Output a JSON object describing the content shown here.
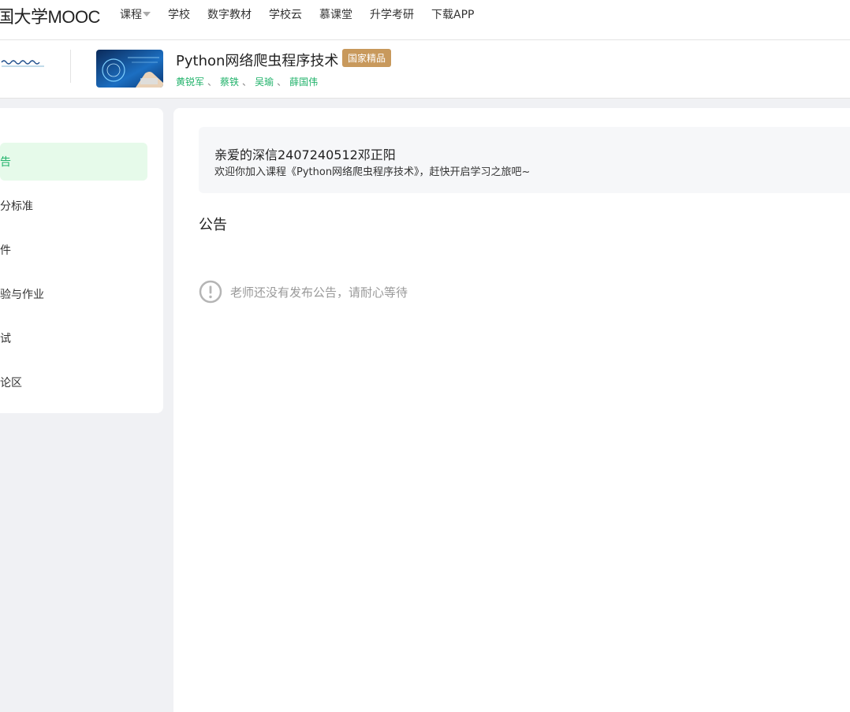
{
  "site": {
    "logo_text": "国大学MOOC"
  },
  "nav": {
    "items": [
      {
        "label": "课程",
        "has_caret": true
      },
      {
        "label": "学校"
      },
      {
        "label": "数字教材"
      },
      {
        "label": "学校云"
      },
      {
        "label": "慕课堂"
      },
      {
        "label": "升学考研"
      },
      {
        "label": "下载APP"
      }
    ]
  },
  "course": {
    "title": "Python网络爬虫程序技术",
    "badge": "国家精品",
    "teachers": [
      "黄锐军",
      "蔡铁",
      "吴瑜",
      "薛国伟"
    ],
    "teacher_separator": "、"
  },
  "sidebar": {
    "items": [
      {
        "label": "告",
        "active": true
      },
      {
        "label": "分标准"
      },
      {
        "label": "件"
      },
      {
        "label": "验与作业"
      },
      {
        "label": "试"
      },
      {
        "label": "论区"
      }
    ]
  },
  "welcome": {
    "name_line": "亲爱的深信2407240512邓正阳",
    "message": "欢迎你加入课程《Python网络爬虫程序技术》，赶快开启学习之旅吧~"
  },
  "announcements": {
    "title": "公告",
    "empty_text": "老师还没有发布公告，请耐心等待"
  },
  "colors": {
    "accent": "#20b26a",
    "badge": "#c8995c",
    "active_bg": "#e6faea"
  }
}
